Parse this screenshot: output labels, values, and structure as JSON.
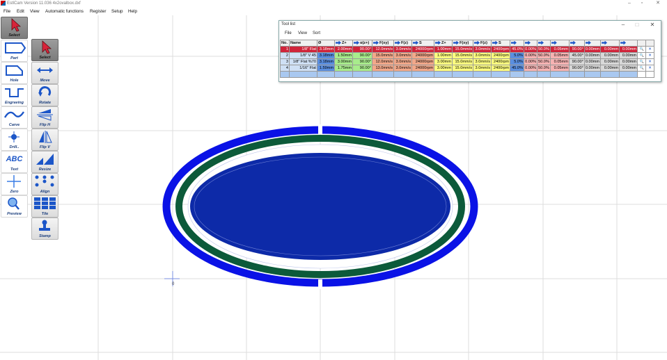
{
  "window": {
    "title": "EstlCam Version 11.036 4x2ovalbox.dxf",
    "minimize": "–",
    "restore": "▫",
    "close": "✕"
  },
  "menu": [
    "File",
    "Edit",
    "View",
    "Automatic functions",
    "Register",
    "Setup",
    "Help"
  ],
  "toolbar_left": [
    "Select",
    "Part",
    "Hole",
    "Engraving",
    "Carve",
    "Drill..",
    "Text",
    "Zero",
    "Preview"
  ],
  "toolbar_right": [
    "Select",
    "Move",
    "Rotate",
    "Flip H",
    "Flip V",
    "Resize",
    "Align",
    "Tile",
    "Stamp"
  ],
  "text_tool_glyph": "ABC",
  "origin_marker": "0",
  "tool_list": {
    "title": "Tool list",
    "minimize": "–",
    "restore": "□",
    "close": "✕",
    "menu": [
      "File",
      "View",
      "Sort"
    ],
    "headers": [
      "No.",
      "Name",
      "Ø",
      "Z+",
      "α(z+)",
      "F(xy)",
      "F(z)",
      "S",
      "Z+",
      "F(xy)",
      "F(z)",
      "S",
      "",
      "",
      "",
      "",
      "",
      "",
      "",
      ""
    ],
    "rows": [
      [
        "1",
        "1/8\" Flat",
        "3.18mm",
        "2.00mm",
        "90.00°",
        "12.0mm/s",
        "3.0mm/s",
        "24000rpm",
        "1.00mm",
        "15.0mm/s",
        "3.0mm/s",
        "2400rpm",
        "45.0%",
        "0.00%",
        "50.0%",
        "0.05mm",
        "90.00°",
        "0.00mm",
        "0.00mm",
        "0.00mm"
      ],
      [
        "2",
        "1/8\" V 45",
        "3.18mm",
        "1.50mm",
        "90.00°",
        "15.0mm/s",
        "3.0mm/s",
        "24000rpm",
        "1.00mm",
        "15.0mm/s",
        "3.0mm/s",
        "2400rpm",
        "5.0%",
        "0.00%",
        "50.0%",
        "0.05mm",
        "45.00°",
        "0.00mm",
        "0.00mm",
        "0.00mm"
      ],
      [
        "3",
        "1/8\" Flat %70",
        "3.18mm",
        "3.00mm",
        "90.00°",
        "12.0mm/s",
        "3.0mm/s",
        "24000rpm",
        "3.00mm",
        "15.0mm/s",
        "3.0mm/s",
        "2400rpm",
        "5.0%",
        "0.00%",
        "50.0%",
        "0.05mm",
        "90.00°",
        "0.00mm",
        "0.00mm",
        "0.00mm"
      ],
      [
        "4",
        "1/16\" Flat",
        "1.59mm",
        "1.75mm",
        "90.00°",
        "13.0mm/s",
        "3.0mm/s",
        "24000rpm",
        "3.00mm",
        "15.0mm/s",
        "3.0mm/s",
        "2400rpm",
        "45.0%",
        "0.00%",
        "50.0%",
        "0.05mm",
        "90.00°",
        "0.00mm",
        "0.00mm",
        "0.00mm"
      ]
    ],
    "column_colors": [
      "#cfe0f5",
      "#cfe0f5",
      "#5b8fe0",
      "#a8ec8c",
      "#a8ec8c",
      "#f2a88a",
      "#f2a88a",
      "#f2a88a",
      "#ffff80",
      "#ffff80",
      "#ffff80",
      "#ffff80",
      "#5b8fe0",
      "#f7b3b3",
      "#f7b3b3",
      "#f7b3b3",
      "#d8d8d8",
      "#d8d8d8",
      "#d8d8d8",
      "#d8d8d8"
    ]
  },
  "colors": {
    "outer_ring": "#0a12e6",
    "green_ring": "#0c5a3a",
    "inner_pocket": "#0d2aa8",
    "grid": "#dcdcdc",
    "selected_row": "#d0243a"
  }
}
